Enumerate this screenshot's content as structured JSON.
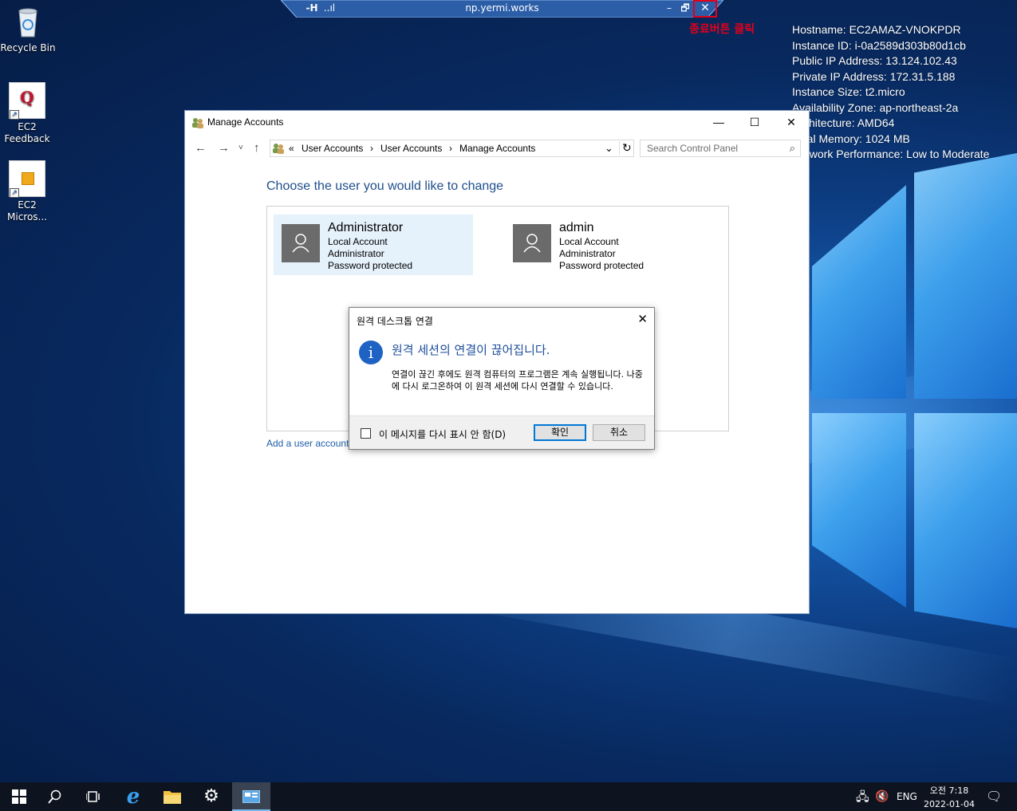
{
  "desktop": {
    "icons": [
      {
        "label": "Recycle Bin"
      },
      {
        "label": "EC2 Feedback"
      },
      {
        "label": "EC2 Micros..."
      }
    ]
  },
  "rdp_bar": {
    "title": "np.yermi.works",
    "pin_label": "-H",
    "signal_label": "..ıl",
    "minimize": "–",
    "restore": "🗗",
    "close": "✕"
  },
  "annotation": "종료버튼 클릭",
  "sysinfo": [
    "Hostname: EC2AMAZ-VNOKPDR",
    "Instance ID: i-0a2589d303b80d1cb",
    "Public IP Address: 13.124.102.43",
    "Private IP Address: 172.31.5.188",
    "Instance Size: t2.micro",
    "Availability Zone: ap-northeast-2a",
    "Architecture: AMD64",
    "Total Memory: 1024 MB",
    "Network Performance: Low to Moderate"
  ],
  "window": {
    "title": "Manage Accounts",
    "breadcrumb": [
      "«",
      "User Accounts",
      "›",
      "User Accounts",
      "›",
      "Manage Accounts"
    ],
    "search_placeholder": "Search Control Panel",
    "heading": "Choose the user you would like to change",
    "accounts": [
      {
        "name": "Administrator",
        "lines": [
          "Local Account",
          "Administrator",
          "Password protected"
        ],
        "selected": true
      },
      {
        "name": "admin",
        "lines": [
          "Local Account",
          "Administrator",
          "Password protected"
        ],
        "selected": false
      }
    ],
    "add_link": "Add a user account"
  },
  "dialog": {
    "title": "원격 데스크톱 연결",
    "main": "원격 세션의 연결이 끊어집니다.",
    "body": "연결이 끊긴 후에도 원격 컴퓨터의 프로그램은 계속 실행됩니다. 나중에 다시 로그온하여 이 원격 세션에 다시 연결할 수 있습니다.",
    "checkbox_label": "이 메시지를 다시 표시 안 함(D)",
    "ok": "확인",
    "cancel": "취소"
  },
  "taskbar": {
    "lang": "ENG",
    "time": "오전 7:18",
    "date": "2022-01-04"
  }
}
